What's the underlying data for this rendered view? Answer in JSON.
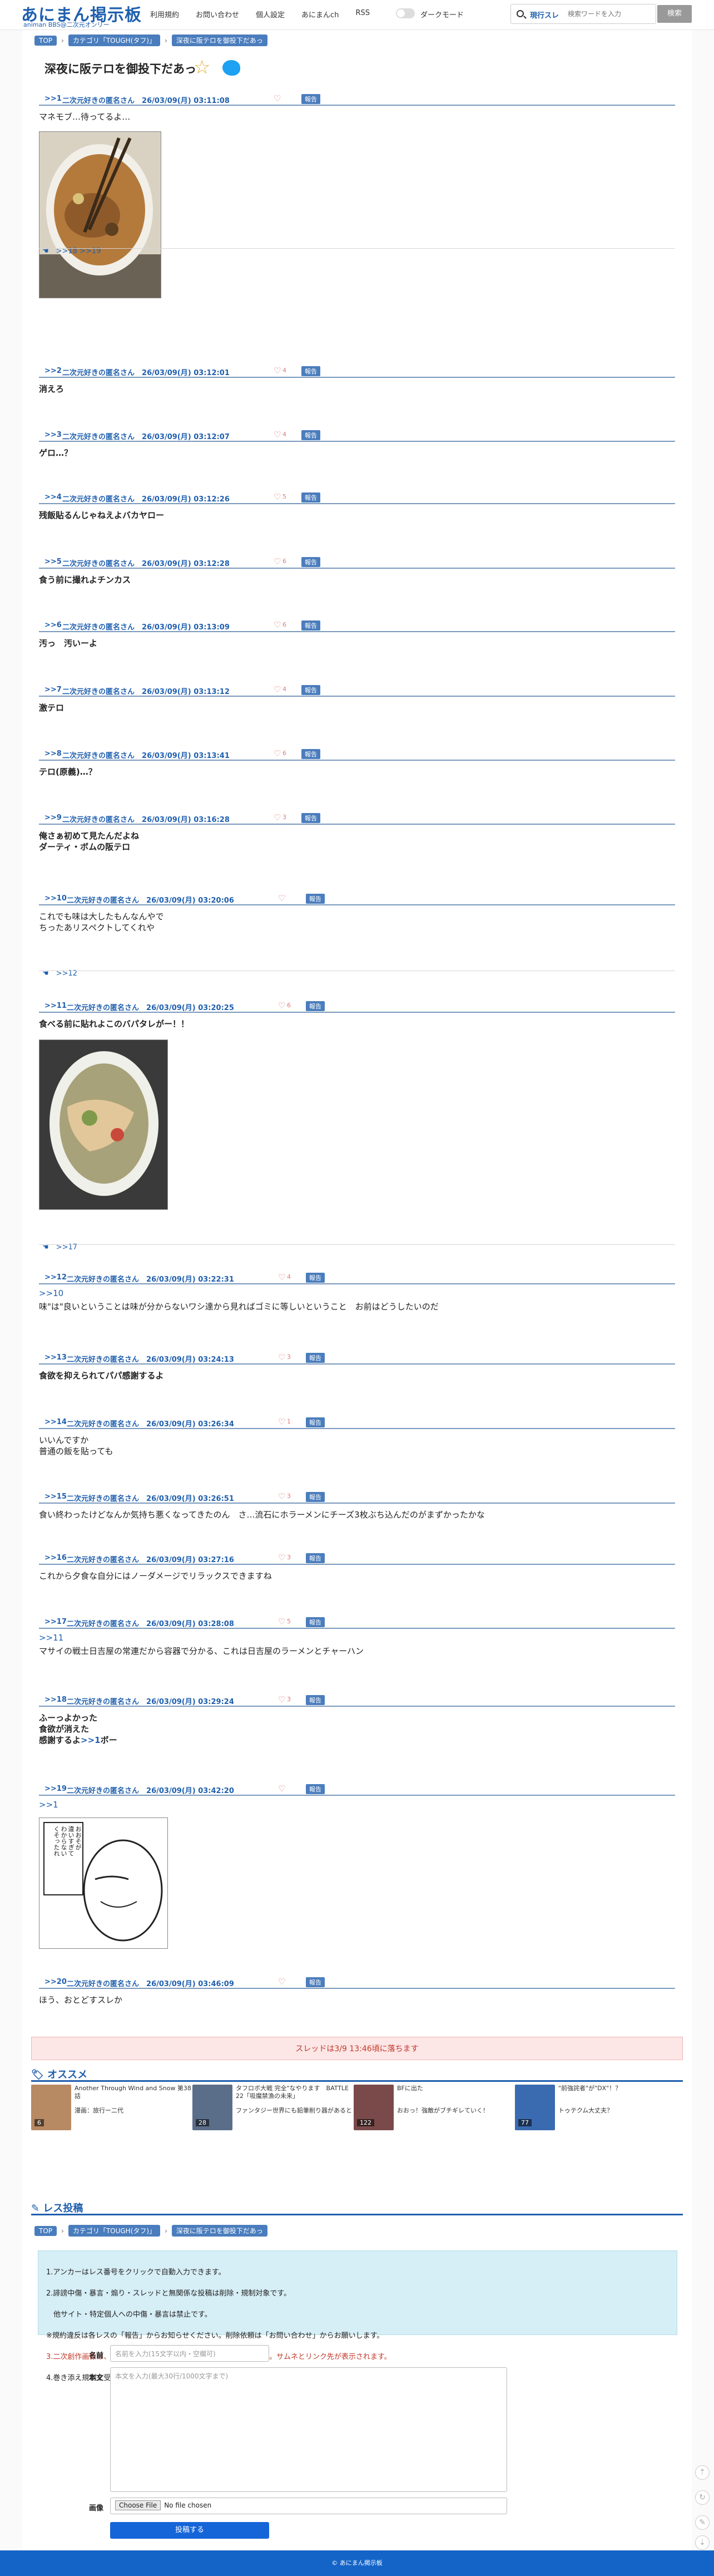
{
  "header": {
    "logo": "あにまん掲示板",
    "logo_sub": "animan BBS@二次元オンリー",
    "nav": [
      "利用規約",
      "お問い合わせ",
      "個人設定",
      "あにまんch",
      "RSS"
    ],
    "dark_mode": "ダークモード",
    "search_scope": "現行スレ",
    "search_placeholder": "検索ワードを入力",
    "search_button": "検索"
  },
  "breadcrumb": [
    "TOP",
    "カテゴリ「TOUGH(タフ)」",
    "深夜に阪テロを御投下だあっ"
  ],
  "thread_title": "深夜に阪テロを御投下だあっ",
  "report_label": "報告",
  "posts": [
    {
      "num": ">>1",
      "name": "二次元好きの匿名さん",
      "date": "26/03/09(月) 03:11:08",
      "likes": "",
      "body": "マネモブ…待ってるよ…",
      "replies": ">>18  >>19"
    },
    {
      "num": ">>2",
      "name": "二次元好きの匿名さん",
      "date": "26/03/09(月) 03:12:01",
      "likes": "4",
      "body": "消えろ"
    },
    {
      "num": ">>3",
      "name": "二次元好きの匿名さん",
      "date": "26/03/09(月) 03:12:07",
      "likes": "4",
      "body": "ゲロ…？"
    },
    {
      "num": ">>4",
      "name": "二次元好きの匿名さん",
      "date": "26/03/09(月) 03:12:26",
      "likes": "5",
      "body": "残飯貼るんじゃねえよバカヤロー"
    },
    {
      "num": ">>5",
      "name": "二次元好きの匿名さん",
      "date": "26/03/09(月) 03:12:28",
      "likes": "6",
      "body": "食う前に撮れよチンカス"
    },
    {
      "num": ">>6",
      "name": "二次元好きの匿名さん",
      "date": "26/03/09(月) 03:13:09",
      "likes": "6",
      "body": "汚っ　汚いーよ"
    },
    {
      "num": ">>7",
      "name": "二次元好きの匿名さん",
      "date": "26/03/09(月) 03:13:12",
      "likes": "4",
      "body": "激テロ"
    },
    {
      "num": ">>8",
      "name": "二次元好きの匿名さん",
      "date": "26/03/09(月) 03:13:41",
      "likes": "6",
      "body": "テロ(原義)…？"
    },
    {
      "num": ">>9",
      "name": "二次元好きの匿名さん",
      "date": "26/03/09(月) 03:16:28",
      "likes": "3",
      "body": "俺さぁ初めて見たんだよね\nダーティ・ボムの阪テロ"
    },
    {
      "num": ">>10",
      "name": "二次元好きの匿名さん",
      "date": "26/03/09(月) 03:20:06",
      "likes": "",
      "body": "これでも味は大したもんなんやで\nちったあリスペクトしてくれや",
      "replies": ">>12"
    },
    {
      "num": ">>11",
      "name": "二次元好きの匿名さん",
      "date": "26/03/09(月) 03:20:25",
      "likes": "6",
      "body": "食べる前に貼れよこのバパタレがー！！",
      "replies": ">>17"
    },
    {
      "num": ">>12",
      "name": "二次元好きの匿名さん",
      "date": "26/03/09(月) 03:22:31",
      "likes": "4",
      "anchor": ">>10",
      "body": "味\"は\"良いということは味が分からないワシ達から見ればゴミに等しいということ　お前はどうしたいのだ"
    },
    {
      "num": ">>13",
      "name": "二次元好きの匿名さん",
      "date": "26/03/09(月) 03:24:13",
      "likes": "3",
      "body": "食欲を抑えられてパパ感謝するよ"
    },
    {
      "num": ">>14",
      "name": "二次元好きの匿名さん",
      "date": "26/03/09(月) 03:26:34",
      "likes": "1",
      "body": "いいんですか\n普通の飯を貼っても"
    },
    {
      "num": ">>15",
      "name": "二次元好きの匿名さん",
      "date": "26/03/09(月) 03:26:51",
      "likes": "3",
      "body": "食い終わったけどなんか気持ち悪くなってきたのん　さ…流石にホラーメンにチーズ3枚ぶち込んだのがまずかったかな"
    },
    {
      "num": ">>16",
      "name": "二次元好きの匿名さん",
      "date": "26/03/09(月) 03:27:16",
      "likes": "3",
      "body": "これから夕食な自分にはノーダメージでリラックスできますね"
    },
    {
      "num": ">>17",
      "name": "二次元好きの匿名さん",
      "date": "26/03/09(月) 03:28:08",
      "likes": "5",
      "anchor": ">>11",
      "body": "マサイの戦士日吉屋の常連だから容器で分かる、これは日吉屋のラーメンとチャーハン"
    },
    {
      "num": ">>18",
      "name": "二次元好きの匿名さん",
      "date": "26/03/09(月) 03:29:24",
      "likes": "3",
      "body": "ふーっよかった\n食欲が消えた\n感謝するよ",
      "inline_anchor": ">>1",
      "tail": "ボー"
    },
    {
      "num": ">>19",
      "name": "二次元好きの匿名さん",
      "date": "26/03/09(月) 03:42:20",
      "likes": "",
      "anchor": ">>1",
      "body": ""
    },
    {
      "num": ">>20",
      "name": "二次元好きの匿名さん",
      "date": "26/03/09(月) 03:46:09",
      "likes": "",
      "body": "ほう、おとどすスレか"
    }
  ],
  "manga_text": "おおそが\n違いすぎて\nわからない\nくそったれ",
  "expire_notice": "スレッドは3/9 13:46頃に落ちます",
  "recommend": {
    "heading": "オススメ",
    "items": [
      {
        "title": "Another Through Wind and Snow 第38話",
        "title2": "漫画：旅行ー二代",
        "count": "6"
      },
      {
        "title": "タフロボ大戦 完全\"なやります　BATTLE 22「吸魔禁漁の未来」",
        "title2": "ファンタジー世界にも鉛筆削り器があると",
        "count": "28"
      },
      {
        "title": "BFに出た",
        "title2": "おおっ！強敵がブチギレていく！",
        "count": "122"
      },
      {
        "title": "\"前強詫者\"が\"DX\"！？",
        "title2": "トゥテクム大丈夫？",
        "count": "77"
      }
    ]
  },
  "reply_form": {
    "heading": "レス投稿",
    "info_lines": [
      "1.アンカーはレス番号をクリックで自動入力できます。",
      "2.誹謗中傷・暴言・煽り・スレッドと無関係な投稿は削除・規制対象です。",
      "　他サイト・特定個人への中傷・暴言は禁止です。",
      "※規約違反は各レスの「報告」からお知らせください。削除依頼は「お問い合わせ」からお願いします。",
      "3.二次創作画像は、作者本人でない場合は必ずURLで貼ってください。サムネとリンク先が表示されます。",
      "4.巻き添え規制を受けている方や荒らしを反復した方はお問い合わせから連絡をください。"
    ],
    "name_label": "名前",
    "name_placeholder": "名前を入力(15文字以内・空欄可)",
    "body_label": "本文",
    "body_placeholder": "本文を入力(最大30行/1000文字まで)",
    "image_label": "画像",
    "file_button": "Choose File",
    "file_status": "No file chosen",
    "submit": "投稿する"
  },
  "footer": "© あにまん掲示板"
}
